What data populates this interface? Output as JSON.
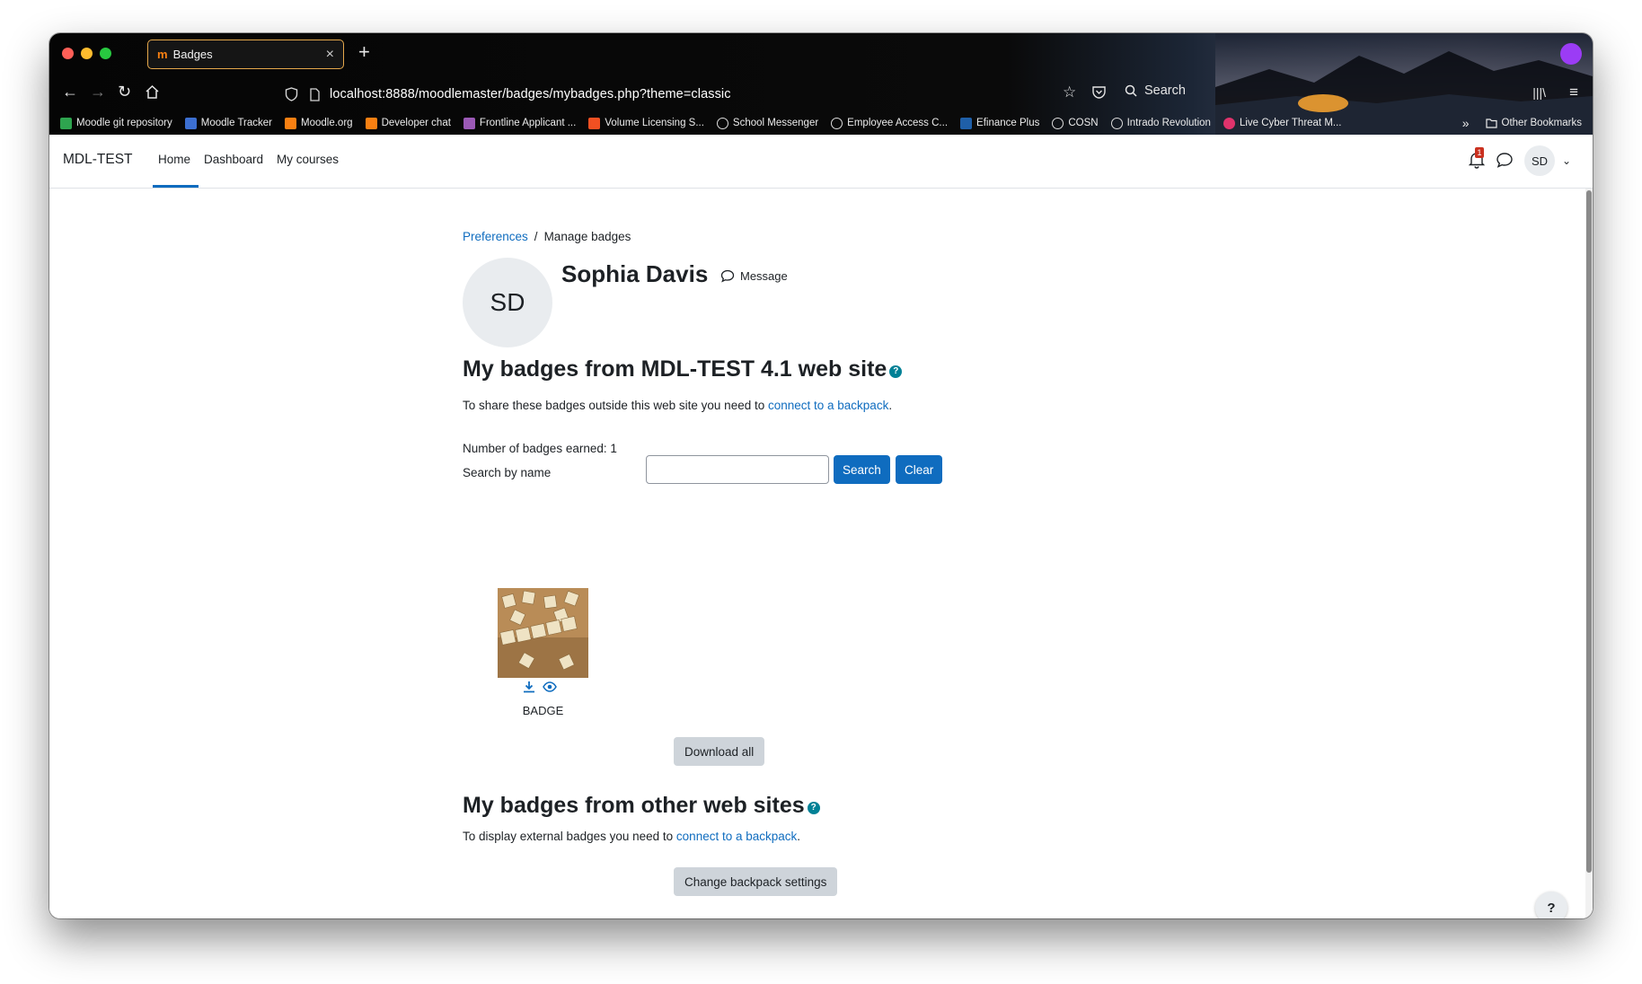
{
  "browser": {
    "tab_title": "Badges",
    "tab_favicon": "m",
    "url": "localhost:8888/moodlemaster/badges/mybadges.php?theme=classic",
    "search_label": "Search",
    "bookmarks": [
      {
        "label": "Moodle git repository",
        "color": "#2ea44f"
      },
      {
        "label": "Moodle Tracker",
        "color": "#3c6fd1"
      },
      {
        "label": "Moodle.org",
        "color": "#f98012"
      },
      {
        "label": "Developer chat",
        "color": "#f98012"
      },
      {
        "label": "Frontline Applicant ...",
        "color": "#9b59b6"
      },
      {
        "label": "Volume Licensing S...",
        "color": "#f25022"
      },
      {
        "label": "School Messenger",
        "color": "globe"
      },
      {
        "label": "Employee Access C...",
        "color": "globe"
      },
      {
        "label": "Efinance Plus",
        "color": "#1f5fa8"
      },
      {
        "label": "COSN",
        "color": "globe"
      },
      {
        "label": "Intrado Revolution",
        "color": "globe"
      },
      {
        "label": "Live Cyber Threat M...",
        "color": "#e0336c"
      }
    ],
    "other_bookmarks": "Other Bookmarks"
  },
  "topnav": {
    "site_name": "MDL-TEST",
    "links": [
      "Home",
      "Dashboard",
      "My courses"
    ],
    "notification_count": "1",
    "user_initials": "SD"
  },
  "breadcrumb": {
    "parent": "Preferences",
    "separator": "/",
    "current": "Manage badges"
  },
  "profile": {
    "initials": "SD",
    "name": "Sophia Davis",
    "message_label": "Message"
  },
  "site_badges": {
    "heading": "My badges from MDL-TEST 4.1 web site",
    "share_text": "To share these badges outside this web site you need to ",
    "share_link": "connect to a backpack",
    "share_end": ".",
    "count_text": "Number of badges earned: 1",
    "search_label": "Search by name",
    "search_value": "",
    "search_button": "Search",
    "clear_button": "Clear",
    "badges": [
      {
        "name": "BADGE"
      }
    ],
    "download_all": "Download all"
  },
  "other_badges": {
    "heading": "My badges from other web sites",
    "text": "To display external badges you need to ",
    "link": "connect to a backpack",
    "end": ".",
    "settings_button": "Change backpack settings"
  },
  "help_button": "?",
  "colors": {
    "brand": "#0f6cbf",
    "help": "#008196",
    "notification": "#ca3120"
  }
}
